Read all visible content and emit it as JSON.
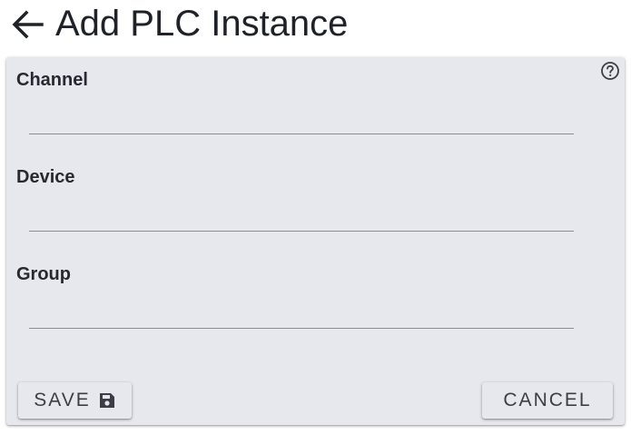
{
  "header": {
    "title": "Add PLC Instance",
    "back_icon": "arrow-left-icon"
  },
  "form": {
    "help_icon": "help-circle-icon",
    "fields": [
      {
        "label": "Channel",
        "value": ""
      },
      {
        "label": "Device",
        "value": ""
      },
      {
        "label": "Group",
        "value": ""
      }
    ]
  },
  "actions": {
    "save_label": "SAVE",
    "save_icon": "floppy-disk-icon",
    "cancel_label": "CANCEL"
  },
  "colors": {
    "card_background": "#e6e8ee",
    "text": "#1f2329",
    "underline": "#8a8d92"
  }
}
